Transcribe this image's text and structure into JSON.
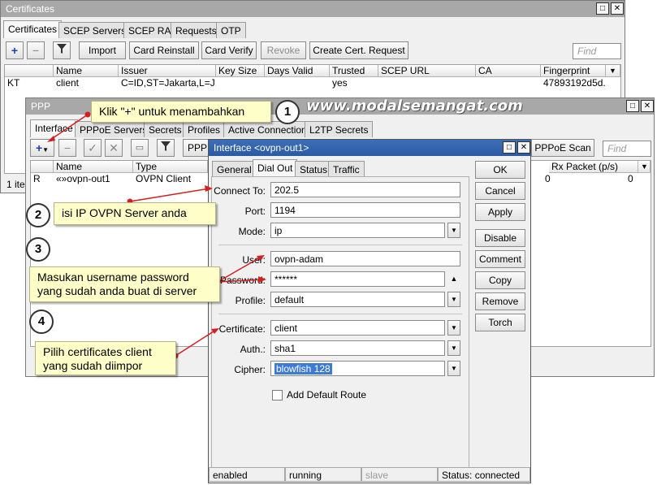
{
  "certificates": {
    "title": "Certificates",
    "tabs": [
      "Certificates",
      "SCEP Servers",
      "SCEP RA",
      "Requests",
      "OTP"
    ],
    "buttons": {
      "import": "Import",
      "card_reinstall": "Card Reinstall",
      "card_verify": "Card Verify",
      "revoke": "Revoke",
      "create_request": "Create Cert. Request"
    },
    "find_placeholder": "Find",
    "columns": [
      "Name",
      "Issuer",
      "Key Size",
      "Days Valid",
      "Trusted",
      "SCEP URL",
      "CA",
      "Fingerprint"
    ],
    "row": {
      "flag": "KT",
      "name": "client",
      "issuer": "C=ID,ST=Jakarta,L=J...",
      "key_size": "",
      "days_valid": "",
      "trusted": "yes",
      "scep_url": "",
      "ca": "",
      "fingerprint": "47893192d5d..."
    },
    "status_items": "1 item"
  },
  "ppp": {
    "title": "PPP",
    "tabs": [
      "Interface",
      "PPPoE Servers",
      "Secrets",
      "Profiles",
      "Active Connections",
      "L2TP Secrets"
    ],
    "btn_ppp": "PPP",
    "btn_pppoe_scan": "PPPoE Scan",
    "find_placeholder": "Find",
    "columns": [
      "Name",
      "Type"
    ],
    "right_column": "Rx Packet (p/s)",
    "row": {
      "flag": "R",
      "name": "«»ovpn-out1",
      "type": "OVPN Client",
      "rx_a": "0",
      "rx_b": "0"
    }
  },
  "dialog": {
    "title": "Interface <ovpn-out1>",
    "tabs": [
      "General",
      "Dial Out",
      "Status",
      "Traffic"
    ],
    "fields": {
      "connect_to": {
        "label": "Connect To:",
        "value": "202.5"
      },
      "port": {
        "label": "Port:",
        "value": "1194"
      },
      "mode": {
        "label": "Mode:",
        "value": "ip"
      },
      "user": {
        "label": "User:",
        "value": "ovpn-adam"
      },
      "password": {
        "label": "Password:",
        "value": "******"
      },
      "profile": {
        "label": "Profile:",
        "value": "default"
      },
      "certificate": {
        "label": "Certificate:",
        "value": "client"
      },
      "auth": {
        "label": "Auth.:",
        "value": "sha1"
      },
      "cipher": {
        "label": "Cipher:",
        "value": "blowfish 128"
      }
    },
    "add_default_route": "Add Default Route",
    "buttons": [
      "OK",
      "Cancel",
      "Apply",
      "Disable",
      "Comment",
      "Copy",
      "Remove",
      "Torch"
    ],
    "status_bar": [
      "enabled",
      "running",
      "slave",
      "Status: connected"
    ]
  },
  "annotations": {
    "watermark": "www.modalsemangat.com",
    "steps": [
      "1",
      "2",
      "3",
      "4"
    ],
    "note1": "Klik \"+\" untuk menambahkan",
    "note2": "isi IP OVPN Server anda",
    "note3_line1": "Masukan username password",
    "note3_line2": "yang sudah anda buat di server",
    "note4_line1": "Pilih certificates client",
    "note4_line2": "yang sudah diimpor"
  },
  "colors": {
    "accent_arrow": "#d41f1f",
    "note_bg": "#fefec9",
    "titlebar_active": "#2a5aa3"
  }
}
